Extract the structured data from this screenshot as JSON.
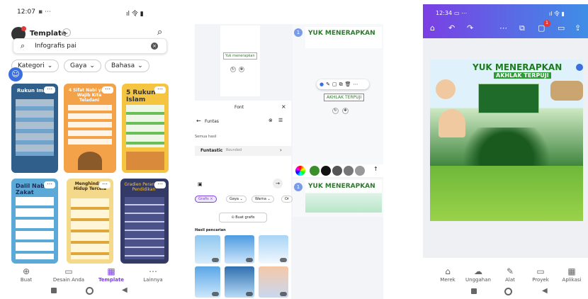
{
  "left": {
    "status_time": "12:07",
    "status_extra": "▪ ⋯",
    "status_right": "ıl 令 ▮",
    "header_title": "Template",
    "search_value": "Infografis pai",
    "filters": [
      "Kategori",
      "Gaya",
      "Bahasa"
    ],
    "cards": [
      {
        "title": "Rukun Iman",
        "bg": "#2f5f8a"
      },
      {
        "title": "4 Sifat Nabi yang Wajib Kita Teladani",
        "bg": "#f3a24a"
      },
      {
        "title": "5 Rukun Islam",
        "bg": "#f5c542"
      },
      {
        "title": "Dalil Nabi Zakat",
        "bg": "#5aa9d6"
      },
      {
        "title": "Menghindari Hidup Tercela",
        "bg": "#e9c15a"
      },
      {
        "title": "Gradien Perantara Pendidikan",
        "bg": "#333a66"
      }
    ],
    "nav": [
      "Buat",
      "Desain Anda",
      "Template",
      "Lainnya"
    ]
  },
  "middle": {
    "top_label": "Yuk menerapkan",
    "font_title": "Font",
    "font_search": "Funtas",
    "results_label": "Semua hasil",
    "font_result": "Funtastic",
    "font_result_sub": "Rounded",
    "graphics_chip": "Grafis",
    "filters2": [
      "Gaya",
      "Warna",
      "Or"
    ],
    "create_graphic": "Buat grafis",
    "search_results": "Hasil pencarian",
    "canvas_heading": "YUK MENERAPKAN",
    "canvas_sub": "AKHLAK TERPUJI",
    "canvas_heading2": "YUK MENERAPKAN",
    "page_num_1": "1",
    "page_num_2": "1",
    "swatches": [
      "#3a8f2c",
      "#111111",
      "#555555",
      "#777777",
      "#999999"
    ]
  },
  "right": {
    "status_time": "12:34",
    "status_extra": "▭ ⋯",
    "status_right": "ıl 令 ▮",
    "notif_count": "1",
    "poster_title": "YUK MENERAPKAN",
    "poster_subtitle": "AKHLAK TERPUJI",
    "nav": [
      "Merek",
      "Unggahan",
      "Alat",
      "Proyek",
      "Aplikasi"
    ]
  }
}
